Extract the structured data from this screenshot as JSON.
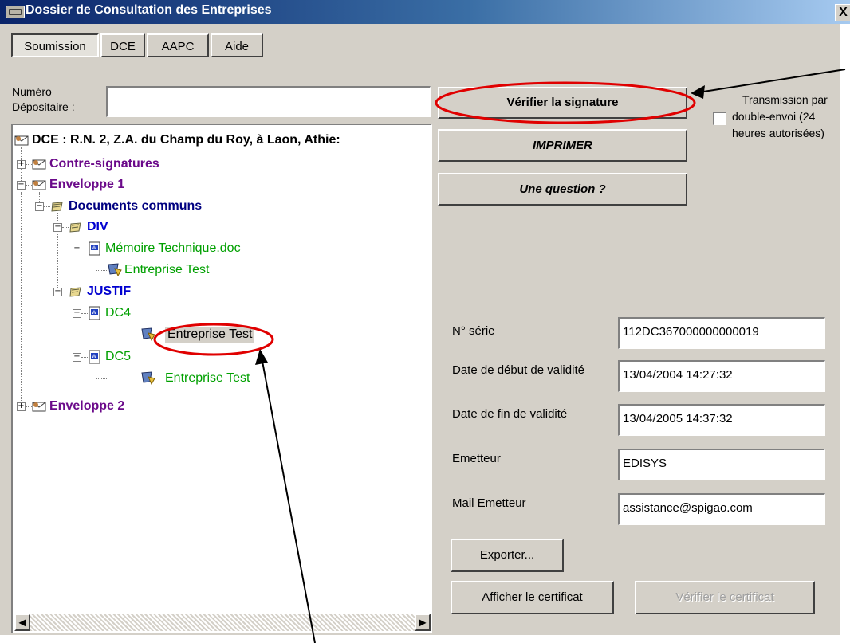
{
  "window": {
    "title": "Dossier de Consultation des Entreprises",
    "close_label": "X"
  },
  "tabs": [
    {
      "label": "Soumission",
      "active": true
    },
    {
      "label": "DCE",
      "active": false
    },
    {
      "label": "AAPC",
      "active": false
    },
    {
      "label": "Aide",
      "active": false
    }
  ],
  "depositaire": {
    "label_line1": "Numéro",
    "label_line2": "Dépositaire :",
    "value": ""
  },
  "tree": {
    "root": "DCE : R.N. 2, Z.A. du Champ du Roy, à Laon, Athie:",
    "contre_signatures": "Contre-signatures",
    "enveloppe1": "Enveloppe 1",
    "documents_communs": "Documents communs",
    "div": "DIV",
    "memoire": "Mémoire Technique.doc",
    "entreprise_test_1": "Entreprise Test",
    "justif": "JUSTIF",
    "dc4": "DC4",
    "entreprise_test_2": "Entreprise Test",
    "dc5": "DC5",
    "entreprise_test_3": "Entreprise Test",
    "enveloppe2": "Enveloppe 2"
  },
  "buttons": {
    "verifier_signature": "Vérifier la signature",
    "imprimer": "IMPRIMER",
    "question": "Une question ?",
    "exporter": "Exporter...",
    "afficher_certificat": "Afficher le certificat",
    "verifier_certificat": "Vérifier le certificat"
  },
  "transmission": {
    "line1": "Transmission par",
    "line2": "double-envoi (24",
    "line3": "heures autorisées)",
    "checked": false
  },
  "certificate": {
    "serie_label": "N° série",
    "serie_value": "112DC367000000000019",
    "debut_label": "Date de début de validité",
    "debut_value": "13/04/2004 14:27:32",
    "fin_label": "Date de fin de validité",
    "fin_value": "13/04/2005 14:37:32",
    "emetteur_label": "Emetteur",
    "emetteur_value": "EDISYS",
    "mail_label": "Mail Emetteur",
    "mail_value": "assistance@spigao.com"
  },
  "annotation_colors": {
    "highlight": "#e00000",
    "arrow": "#000000"
  }
}
